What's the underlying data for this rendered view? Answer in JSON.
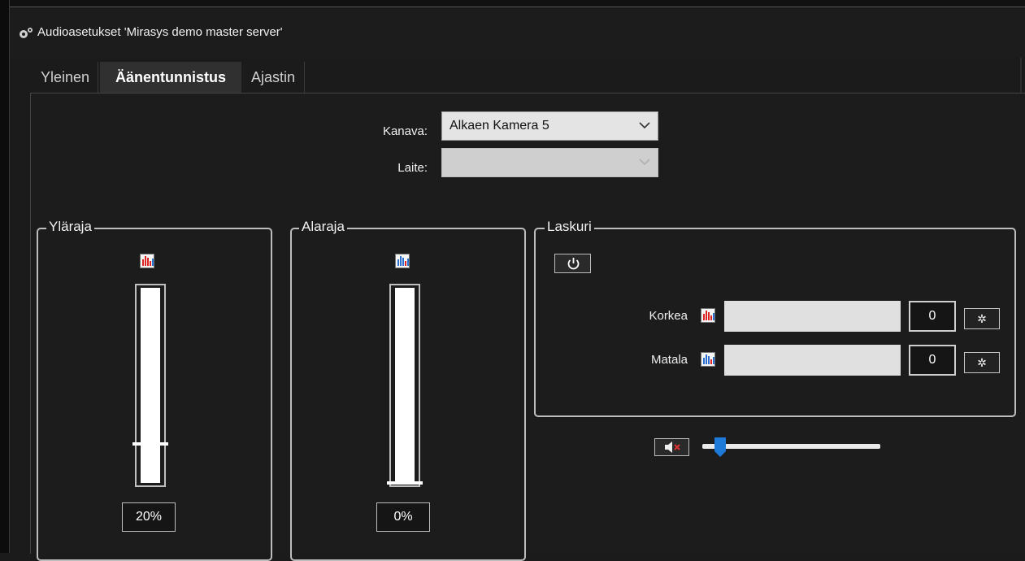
{
  "window": {
    "title": "Audioasetukset 'Mirasys demo master server'",
    "title_icon": "gear-icon"
  },
  "tabs": [
    {
      "label": "Yleinen",
      "active": false
    },
    {
      "label": "Äänentunnistus",
      "active": true
    },
    {
      "label": "Ajastin",
      "active": false
    }
  ],
  "form": {
    "channel_label": "Kanava:",
    "channel_value": "Alkaen Kamera 5",
    "device_label": "Laite:",
    "device_value": ""
  },
  "upper_limit": {
    "title": "Yläraja",
    "value_text": "20%",
    "level": 0.2,
    "icon": "level-meter-red-icon"
  },
  "lower_limit": {
    "title": "Alaraja",
    "value_text": "0%",
    "level": 0.0,
    "icon": "level-meter-blue-icon"
  },
  "counter": {
    "title": "Laskuri",
    "power_icon": "power-icon",
    "rows": [
      {
        "label": "Korkea",
        "icon": "level-meter-red-icon",
        "count": "0",
        "reset_icon": "reset-icon"
      },
      {
        "label": "Matala",
        "icon": "level-meter-blue-icon",
        "count": "0",
        "reset_icon": "reset-icon"
      }
    ]
  },
  "volume": {
    "mute_icon": "speaker-muted-icon",
    "level": 0.1
  },
  "colors": {
    "accent_blue": "#1e7ad8",
    "mute_red": "#e03030",
    "background": "#1c1c1c"
  }
}
